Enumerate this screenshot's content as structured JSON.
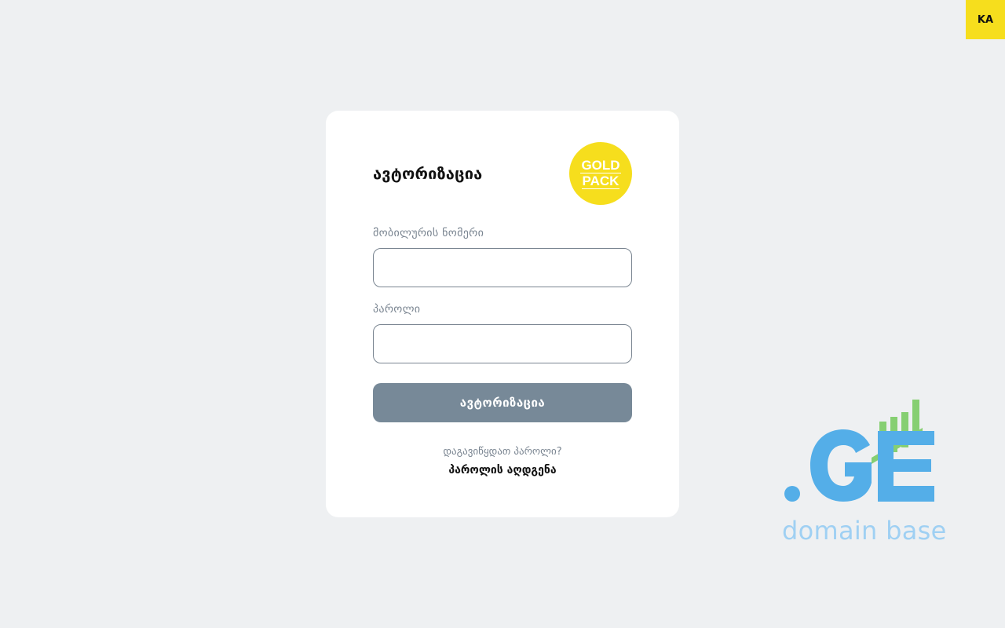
{
  "language": {
    "label": "KA"
  },
  "login": {
    "title": "ავტორიზაცია",
    "badge_line1": "GOLD",
    "badge_line2": "PACK",
    "phone_label": "მობილურის ნომერი",
    "phone_value": "",
    "password_label": "პაროლი",
    "password_value": "",
    "submit_label": "ავტორიზაცია",
    "forgot_text": "დაგავიწყდათ პაროლი?",
    "recover_link": "პაროლის აღდგენა"
  },
  "logo": {
    "text": ".GE",
    "subtitle": "domain base"
  },
  "colors": {
    "background": "#eef0f2",
    "accent_yellow": "#f6de1d",
    "button_gray": "#778998",
    "logo_blue": "#54aee8",
    "logo_green": "#86cf72",
    "logo_sub": "#9fd0f3"
  }
}
